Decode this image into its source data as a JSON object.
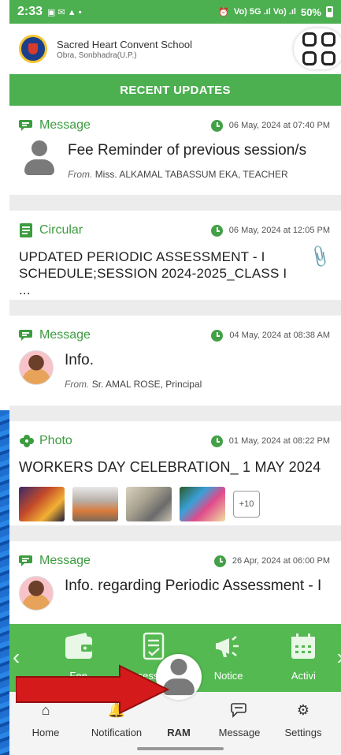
{
  "statusbar": {
    "time": "2:33",
    "indicators": "Vo) 5G .ıl Vo) .ıl",
    "battery": "50%"
  },
  "header": {
    "school_name": "Sacred Heart Convent School",
    "school_place": "Obra, Sonbhadra(U.P.)"
  },
  "banner": {
    "title": "RECENT UPDATES"
  },
  "feed": [
    {
      "kind": "message",
      "type_label": "Message",
      "date": "06 May, 2024 at 07:40 PM",
      "title": "Fee Reminder of previous session/s",
      "from_prefix": "From.",
      "from": "Miss. ALKAMAL TABASSUM EKA, TEACHER"
    },
    {
      "kind": "circular",
      "type_label": "Circular",
      "date": "06 May, 2024 at 12:05 PM",
      "title": "UPDATED PERIODIC ASSESSMENT - I SCHEDULE;SESSION 2024-2025_CLASS I ..."
    },
    {
      "kind": "message",
      "type_label": "Message",
      "date": "04 May, 2024 at 08:38 AM",
      "title": "Info.",
      "from_prefix": "From.",
      "from": "Sr. AMAL ROSE, Principal"
    },
    {
      "kind": "photo",
      "type_label": "Photo",
      "date": "01 May, 2024 at 08:22 PM",
      "title": "WORKERS DAY CELEBRATION_ 1 MAY 2024",
      "more": "+10"
    },
    {
      "kind": "message",
      "type_label": "Message",
      "date": "26 Apr, 2024 at 06:00 PM",
      "title": "Info. regarding Periodic Assessment - I"
    }
  ],
  "quick_menu": [
    "Fee",
    "Assessment",
    "Notice",
    "Activi"
  ],
  "bottom_nav": [
    "Home",
    "Notification",
    "RAM",
    "Message",
    "Settings"
  ],
  "colors": {
    "primary_green": "#4caf50",
    "quick_green": "#54b951",
    "type_green": "#3c9c3f",
    "arrow_red": "#d41a1a"
  }
}
